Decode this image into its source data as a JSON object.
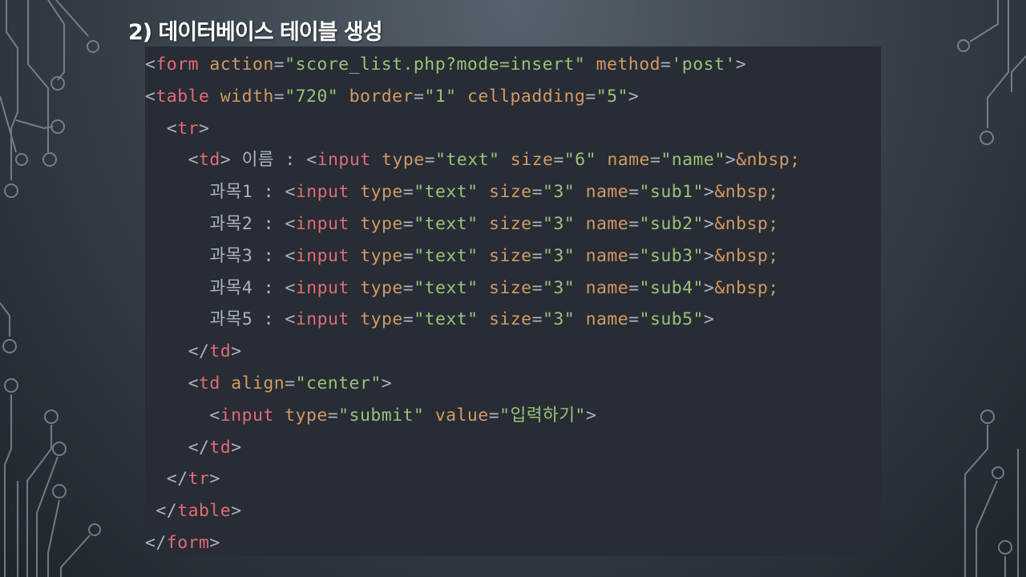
{
  "slide": {
    "title": "2) 데이터베이스 테이블 생성"
  },
  "code": {
    "lines": [
      {
        "indent": 0,
        "tokens": [
          {
            "c": "p",
            "v": "<"
          },
          {
            "c": "t",
            "v": "form"
          },
          {
            "c": "p",
            "v": " "
          },
          {
            "c": "a",
            "v": "action"
          },
          {
            "c": "p",
            "v": "="
          },
          {
            "c": "s",
            "v": "\"score_list.php?mode=insert\""
          },
          {
            "c": "p",
            "v": " "
          },
          {
            "c": "a",
            "v": "method"
          },
          {
            "c": "p",
            "v": "="
          },
          {
            "c": "s",
            "v": "'post'"
          },
          {
            "c": "p",
            "v": ">"
          }
        ]
      },
      {
        "indent": 0,
        "tokens": [
          {
            "c": "p",
            "v": "<"
          },
          {
            "c": "t",
            "v": "table"
          },
          {
            "c": "p",
            "v": " "
          },
          {
            "c": "a",
            "v": "width"
          },
          {
            "c": "p",
            "v": "="
          },
          {
            "c": "s",
            "v": "\"720\""
          },
          {
            "c": "p",
            "v": " "
          },
          {
            "c": "a",
            "v": "border"
          },
          {
            "c": "p",
            "v": "="
          },
          {
            "c": "s",
            "v": "\"1\""
          },
          {
            "c": "p",
            "v": " "
          },
          {
            "c": "a",
            "v": "cellpadding"
          },
          {
            "c": "p",
            "v": "="
          },
          {
            "c": "s",
            "v": "\"5\""
          },
          {
            "c": "p",
            "v": ">"
          }
        ]
      },
      {
        "indent": 2,
        "tokens": [
          {
            "c": "p",
            "v": "<"
          },
          {
            "c": "t",
            "v": "tr"
          },
          {
            "c": "p",
            "v": ">"
          }
        ]
      },
      {
        "indent": 4,
        "tokens": [
          {
            "c": "p",
            "v": "<"
          },
          {
            "c": "t",
            "v": "td"
          },
          {
            "c": "p",
            "v": ">"
          },
          {
            "c": "x",
            "v": " 이름 : "
          },
          {
            "c": "p",
            "v": "<"
          },
          {
            "c": "t",
            "v": "input"
          },
          {
            "c": "p",
            "v": " "
          },
          {
            "c": "a",
            "v": "type"
          },
          {
            "c": "p",
            "v": "="
          },
          {
            "c": "s",
            "v": "\"text\""
          },
          {
            "c": "p",
            "v": " "
          },
          {
            "c": "a",
            "v": "size"
          },
          {
            "c": "p",
            "v": "="
          },
          {
            "c": "s",
            "v": "\"6\""
          },
          {
            "c": "p",
            "v": " "
          },
          {
            "c": "a",
            "v": "name"
          },
          {
            "c": "p",
            "v": "="
          },
          {
            "c": "s",
            "v": "\"name\""
          },
          {
            "c": "p",
            "v": ">"
          },
          {
            "c": "a",
            "v": "&nbsp;"
          }
        ]
      },
      {
        "indent": 6,
        "tokens": [
          {
            "c": "x",
            "v": "과목1 : "
          },
          {
            "c": "p",
            "v": "<"
          },
          {
            "c": "t",
            "v": "input"
          },
          {
            "c": "p",
            "v": " "
          },
          {
            "c": "a",
            "v": "type"
          },
          {
            "c": "p",
            "v": "="
          },
          {
            "c": "s",
            "v": "\"text\""
          },
          {
            "c": "p",
            "v": " "
          },
          {
            "c": "a",
            "v": "size"
          },
          {
            "c": "p",
            "v": "="
          },
          {
            "c": "s",
            "v": "\"3\""
          },
          {
            "c": "p",
            "v": " "
          },
          {
            "c": "a",
            "v": "name"
          },
          {
            "c": "p",
            "v": "="
          },
          {
            "c": "s",
            "v": "\"sub1\""
          },
          {
            "c": "p",
            "v": ">"
          },
          {
            "c": "a",
            "v": "&nbsp;"
          }
        ]
      },
      {
        "indent": 6,
        "tokens": [
          {
            "c": "x",
            "v": "과목2 : "
          },
          {
            "c": "p",
            "v": "<"
          },
          {
            "c": "t",
            "v": "input"
          },
          {
            "c": "p",
            "v": " "
          },
          {
            "c": "a",
            "v": "type"
          },
          {
            "c": "p",
            "v": "="
          },
          {
            "c": "s",
            "v": "\"text\""
          },
          {
            "c": "p",
            "v": " "
          },
          {
            "c": "a",
            "v": "size"
          },
          {
            "c": "p",
            "v": "="
          },
          {
            "c": "s",
            "v": "\"3\""
          },
          {
            "c": "p",
            "v": " "
          },
          {
            "c": "a",
            "v": "name"
          },
          {
            "c": "p",
            "v": "="
          },
          {
            "c": "s",
            "v": "\"sub2\""
          },
          {
            "c": "p",
            "v": ">"
          },
          {
            "c": "a",
            "v": "&nbsp;"
          }
        ]
      },
      {
        "indent": 6,
        "tokens": [
          {
            "c": "x",
            "v": "과목3 : "
          },
          {
            "c": "p",
            "v": "<"
          },
          {
            "c": "t",
            "v": "input"
          },
          {
            "c": "p",
            "v": " "
          },
          {
            "c": "a",
            "v": "type"
          },
          {
            "c": "p",
            "v": "="
          },
          {
            "c": "s",
            "v": "\"text\""
          },
          {
            "c": "p",
            "v": " "
          },
          {
            "c": "a",
            "v": "size"
          },
          {
            "c": "p",
            "v": "="
          },
          {
            "c": "s",
            "v": "\"3\""
          },
          {
            "c": "p",
            "v": " "
          },
          {
            "c": "a",
            "v": "name"
          },
          {
            "c": "p",
            "v": "="
          },
          {
            "c": "s",
            "v": "\"sub3\""
          },
          {
            "c": "p",
            "v": ">"
          },
          {
            "c": "a",
            "v": "&nbsp;"
          }
        ]
      },
      {
        "indent": 6,
        "tokens": [
          {
            "c": "x",
            "v": "과목4 : "
          },
          {
            "c": "p",
            "v": "<"
          },
          {
            "c": "t",
            "v": "input"
          },
          {
            "c": "p",
            "v": " "
          },
          {
            "c": "a",
            "v": "type"
          },
          {
            "c": "p",
            "v": "="
          },
          {
            "c": "s",
            "v": "\"text\""
          },
          {
            "c": "p",
            "v": " "
          },
          {
            "c": "a",
            "v": "size"
          },
          {
            "c": "p",
            "v": "="
          },
          {
            "c": "s",
            "v": "\"3\""
          },
          {
            "c": "p",
            "v": " "
          },
          {
            "c": "a",
            "v": "name"
          },
          {
            "c": "p",
            "v": "="
          },
          {
            "c": "s",
            "v": "\"sub4\""
          },
          {
            "c": "p",
            "v": ">"
          },
          {
            "c": "a",
            "v": "&nbsp;"
          }
        ]
      },
      {
        "indent": 6,
        "tokens": [
          {
            "c": "x",
            "v": "과목5 : "
          },
          {
            "c": "p",
            "v": "<"
          },
          {
            "c": "t",
            "v": "input"
          },
          {
            "c": "p",
            "v": " "
          },
          {
            "c": "a",
            "v": "type"
          },
          {
            "c": "p",
            "v": "="
          },
          {
            "c": "s",
            "v": "\"text\""
          },
          {
            "c": "p",
            "v": " "
          },
          {
            "c": "a",
            "v": "size"
          },
          {
            "c": "p",
            "v": "="
          },
          {
            "c": "s",
            "v": "\"3\""
          },
          {
            "c": "p",
            "v": " "
          },
          {
            "c": "a",
            "v": "name"
          },
          {
            "c": "p",
            "v": "="
          },
          {
            "c": "s",
            "v": "\"sub5\""
          },
          {
            "c": "p",
            "v": ">"
          }
        ]
      },
      {
        "indent": 4,
        "tokens": [
          {
            "c": "p",
            "v": "</"
          },
          {
            "c": "t",
            "v": "td"
          },
          {
            "c": "p",
            "v": ">"
          }
        ]
      },
      {
        "indent": 4,
        "tokens": [
          {
            "c": "p",
            "v": "<"
          },
          {
            "c": "t",
            "v": "td"
          },
          {
            "c": "p",
            "v": " "
          },
          {
            "c": "a",
            "v": "align"
          },
          {
            "c": "p",
            "v": "="
          },
          {
            "c": "s",
            "v": "\"center\""
          },
          {
            "c": "p",
            "v": ">"
          }
        ]
      },
      {
        "indent": 6,
        "tokens": [
          {
            "c": "p",
            "v": "<"
          },
          {
            "c": "t",
            "v": "input"
          },
          {
            "c": "p",
            "v": " "
          },
          {
            "c": "a",
            "v": "type"
          },
          {
            "c": "p",
            "v": "="
          },
          {
            "c": "s",
            "v": "\"submit\""
          },
          {
            "c": "p",
            "v": " "
          },
          {
            "c": "a",
            "v": "value"
          },
          {
            "c": "p",
            "v": "="
          },
          {
            "c": "s",
            "v": "\"입력하기\""
          },
          {
            "c": "p",
            "v": ">"
          }
        ]
      },
      {
        "indent": 4,
        "tokens": [
          {
            "c": "p",
            "v": "</"
          },
          {
            "c": "t",
            "v": "td"
          },
          {
            "c": "p",
            "v": ">"
          }
        ]
      },
      {
        "indent": 2,
        "tokens": [
          {
            "c": "p",
            "v": "</"
          },
          {
            "c": "t",
            "v": "tr"
          },
          {
            "c": "p",
            "v": ">"
          }
        ]
      },
      {
        "indent": 1,
        "tokens": [
          {
            "c": "p",
            "v": "</"
          },
          {
            "c": "t",
            "v": "table"
          },
          {
            "c": "p",
            "v": ">"
          }
        ]
      },
      {
        "indent": 0,
        "tokens": [
          {
            "c": "p",
            "v": "</"
          },
          {
            "c": "t",
            "v": "form"
          },
          {
            "c": "p",
            "v": ">"
          }
        ]
      }
    ]
  },
  "colors": {
    "code_background": "#282c34",
    "tag": "#e06c75",
    "attribute": "#d19a66",
    "string": "#98c379",
    "punctuation": "#abb2bf",
    "slide_title": "#ffffff"
  }
}
